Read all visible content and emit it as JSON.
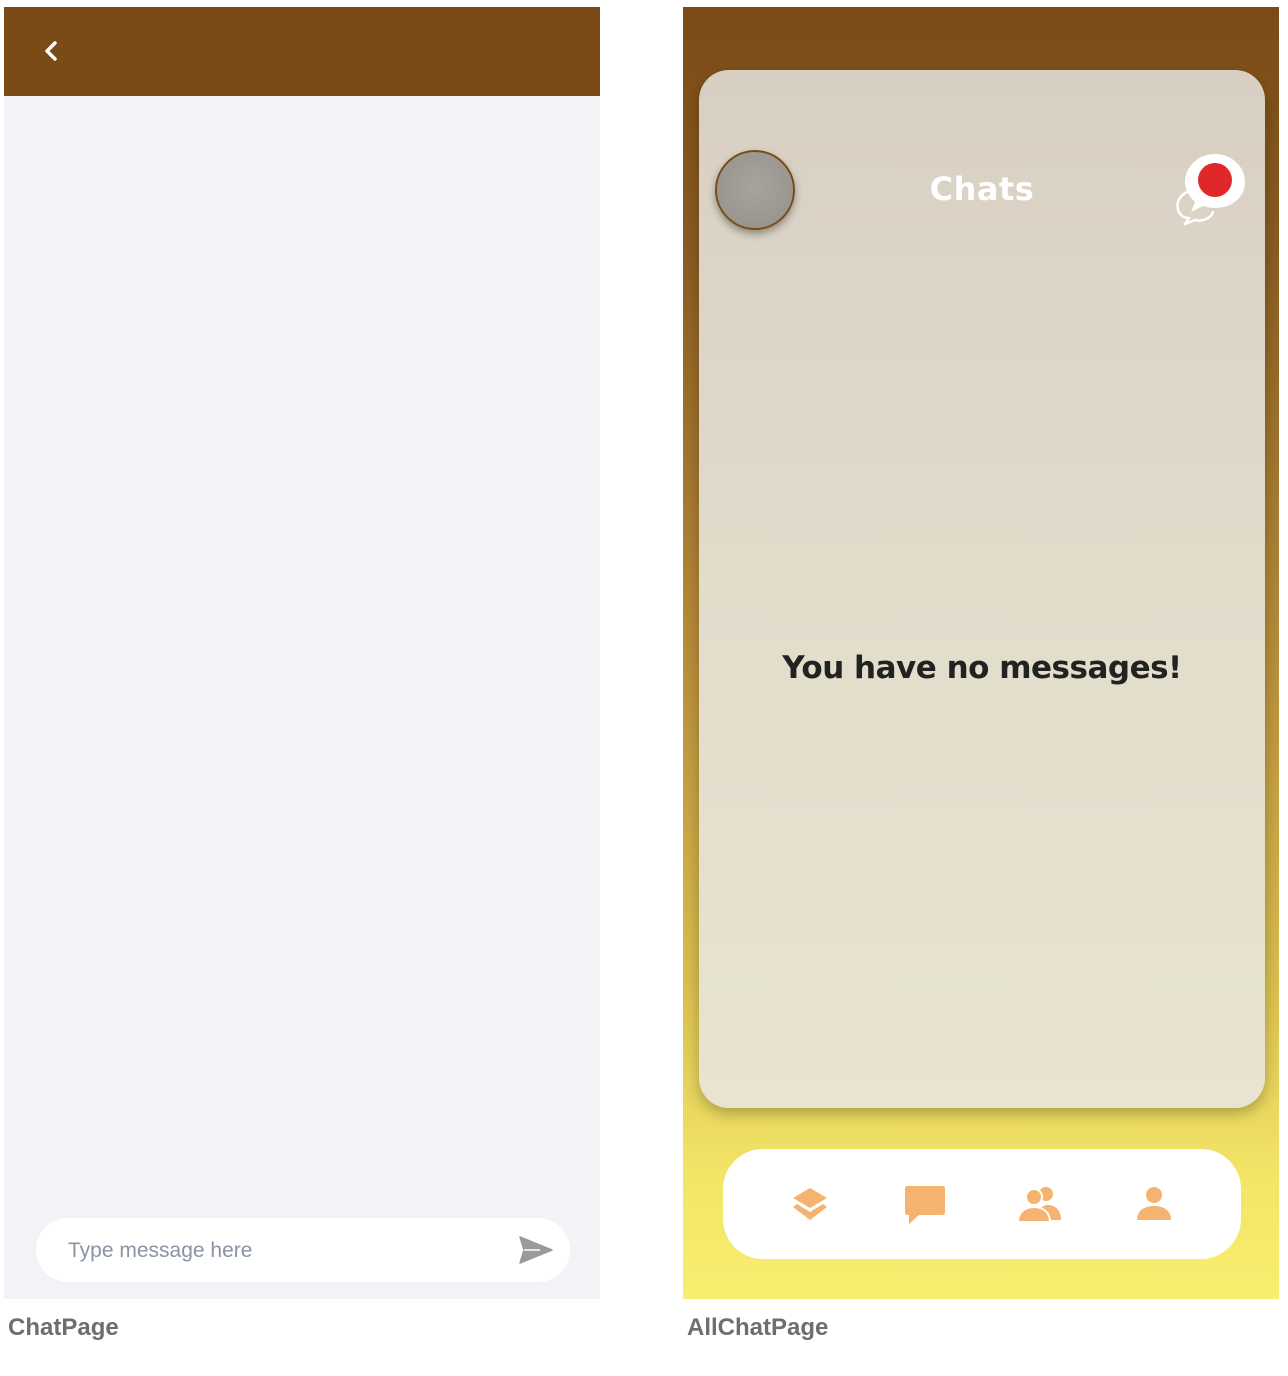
{
  "chat_page": {
    "composer": {
      "placeholder": "Type message here",
      "value": ""
    },
    "icons": {
      "back": "chevron-left-icon",
      "send": "send-icon"
    },
    "colors": {
      "header": "#7a4b17",
      "background": "#f2f3f7"
    },
    "caption": "ChatPage"
  },
  "allchat_page": {
    "title": "Chats",
    "empty_message": "You have no messages!",
    "nav": [
      {
        "icon": "layers-icon"
      },
      {
        "icon": "chat-bubble-icon"
      },
      {
        "icon": "users-icon"
      },
      {
        "icon": "user-icon"
      }
    ],
    "colors": {
      "accent": "#f4b36e",
      "notification": "#e0282a",
      "gradient_top": "#7a4b16",
      "gradient_bottom": "#f8ee70"
    },
    "caption": "AllChatPage"
  }
}
